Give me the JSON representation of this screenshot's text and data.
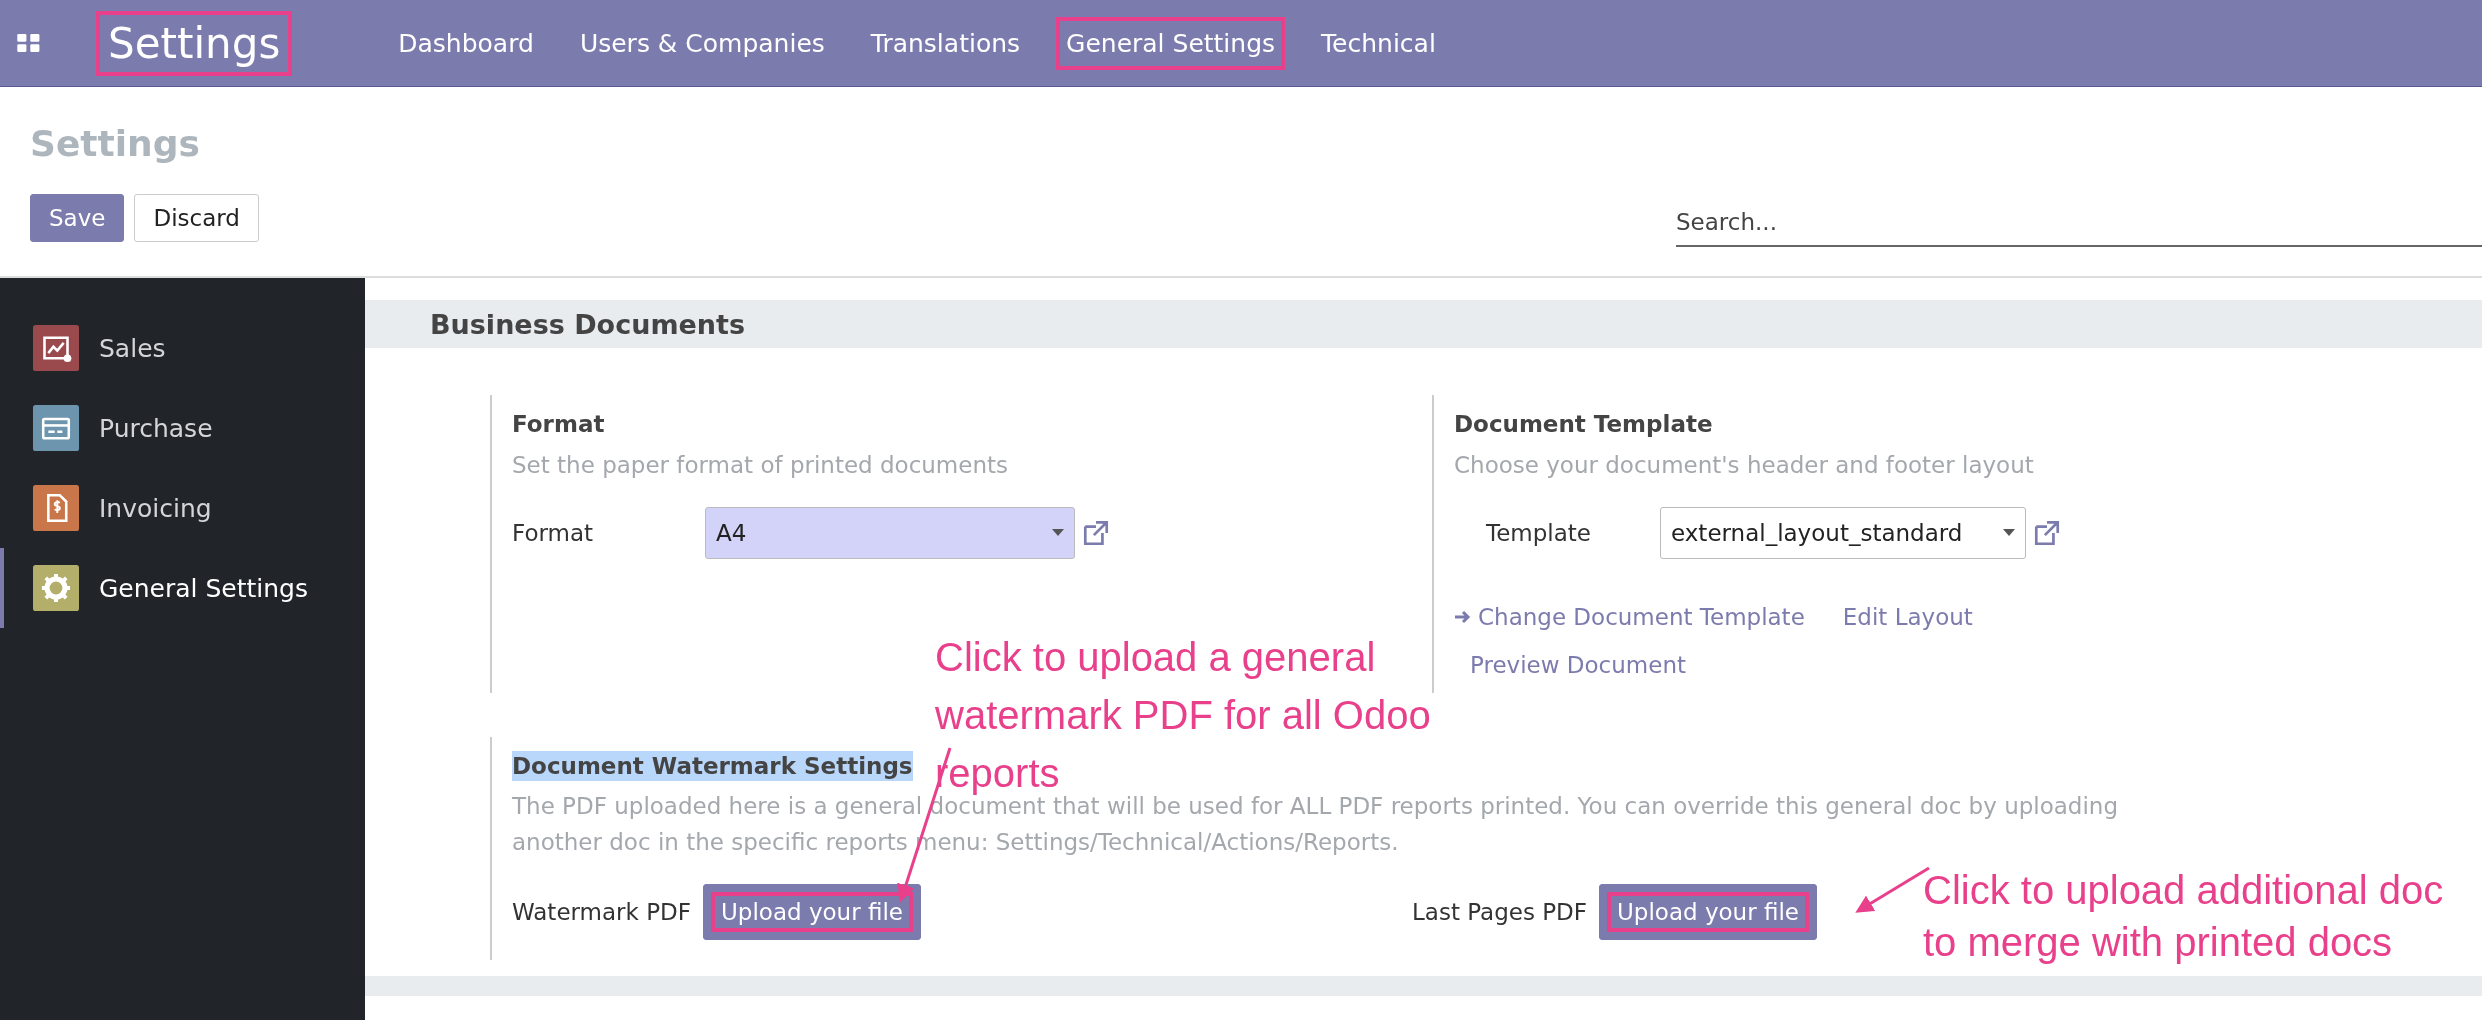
{
  "navbar": {
    "brand": {
      "text": "Settings",
      "highlighted": true
    },
    "menu": [
      {
        "label": "Dashboard",
        "highlighted": false
      },
      {
        "label": "Users & Companies",
        "highlighted": false
      },
      {
        "label": "Translations",
        "highlighted": false
      },
      {
        "label": "General Settings",
        "highlighted": true
      },
      {
        "label": "Technical",
        "highlighted": false
      }
    ]
  },
  "control_panel": {
    "title": "Settings",
    "search": {
      "placeholder": "Search..."
    },
    "buttons": [
      {
        "label": "Save",
        "kind": "primary"
      },
      {
        "label": "Discard",
        "kind": "secondary"
      }
    ]
  },
  "sidebar": {
    "items": [
      {
        "label": "Sales",
        "kind": "chart",
        "color": "#9a4a4c",
        "selected": false
      },
      {
        "label": "Purchase",
        "kind": "card",
        "color": "#6d95ad",
        "selected": false
      },
      {
        "label": "Invoicing",
        "kind": "invoice",
        "color": "#c9764a",
        "selected": false
      },
      {
        "label": "General Settings",
        "kind": "gear",
        "color": "#b4ae6b",
        "selected": true
      }
    ]
  },
  "section": {
    "title": "Business Documents",
    "format_setting": {
      "title": "Format",
      "description": "Set the paper format of printed documents",
      "field_label": "Format",
      "value": "A4"
    },
    "template_setting": {
      "title": "Document Template",
      "description": "Choose your document's header and footer layout",
      "field_label": "Template",
      "value": "external_layout_standard",
      "links": [
        {
          "label": "Change Document Template",
          "kind": "arrow"
        },
        {
          "label": "Edit Layout",
          "kind": "plain"
        },
        {
          "label": "Preview Document",
          "kind": "plain"
        }
      ]
    },
    "watermark_setting": {
      "title": "Document Watermark Settings",
      "title_highlighted": true,
      "description": "The PDF uploaded here is a general document that will be used for ALL PDF reports printed. You can override this general doc by uploading another doc in the specific reports menu: Settings/Technical/Actions/Reports.",
      "fields": [
        {
          "label": "Watermark PDF",
          "button": "Upload your file",
          "highlighted": true
        },
        {
          "label": "Last Pages PDF",
          "button": "Upload your file",
          "highlighted": true
        }
      ]
    }
  },
  "annotations": [
    {
      "text": "Click to upload a general watermark PDF for all Odoo reports"
    },
    {
      "text": "Click to upload additional doc to merge with printed docs"
    }
  ]
}
